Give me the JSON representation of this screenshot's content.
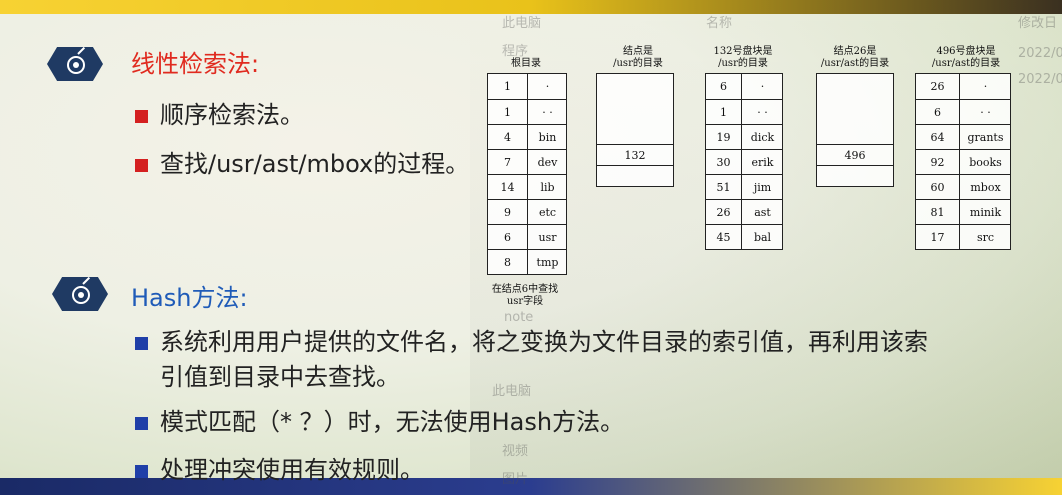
{
  "section1": {
    "title": "线性检索法:",
    "bullets": [
      "顺序检索法。",
      "查找/usr/ast/mbox的过程。"
    ]
  },
  "section2": {
    "title": "Hash方法:",
    "bullets": [
      "系统利用用户提供的文件名，将之变换为文件目录的索引值，再利用该索",
      "引值到目录中去查找。",
      "模式匹配（* ？）时，无法使用Hash方法。",
      "处理冲突使用有效规则。"
    ]
  },
  "diagram": {
    "root": {
      "caption": "根目录",
      "rows": [
        [
          "1",
          "·"
        ],
        [
          "1",
          "· ·"
        ],
        [
          "4",
          "bin"
        ],
        [
          "7",
          "dev"
        ],
        [
          "14",
          "lib"
        ],
        [
          "9",
          "etc"
        ],
        [
          "6",
          "usr"
        ],
        [
          "8",
          "tmp"
        ]
      ],
      "footnote_line1": "在结点6中查找",
      "footnote_line2": "usr字段"
    },
    "node6": {
      "caption_line1": "结点是",
      "caption_line2": "/usr的目录",
      "value": "132"
    },
    "block132": {
      "caption_line1": "132号盘块是",
      "caption_line2": "/usr的目录",
      "rows": [
        [
          "6",
          "·"
        ],
        [
          "1",
          "· ·"
        ],
        [
          "19",
          "dick"
        ],
        [
          "30",
          "erik"
        ],
        [
          "51",
          "jim"
        ],
        [
          "26",
          "ast"
        ],
        [
          "45",
          "bal"
        ]
      ]
    },
    "node26": {
      "caption_line1": "结点26是",
      "caption_line2": "/usr/ast的目录",
      "value": "496"
    },
    "block496": {
      "caption_line1": "496号盘块是",
      "caption_line2": "/usr/ast的目录",
      "rows": [
        [
          "26",
          "·"
        ],
        [
          "6",
          "· ·"
        ],
        [
          "64",
          "grants"
        ],
        [
          "92",
          "books"
        ],
        [
          "60",
          "mbox"
        ],
        [
          "81",
          "minik"
        ],
        [
          "17",
          "src"
        ]
      ]
    }
  },
  "ghost_overlay": {
    "items": [
      "此电脑",
      "程序",
      "名称",
      "修改日",
      "2022/0",
      "2022/0",
      "note",
      "此电脑",
      "视频",
      "图片"
    ]
  },
  "colors": {
    "title_red": "#e02a1f",
    "title_blue": "#1f5bb8",
    "bullet_red": "#d42020",
    "bullet_blue": "#1f3fa8",
    "icon_hex": "#1f3a63"
  }
}
